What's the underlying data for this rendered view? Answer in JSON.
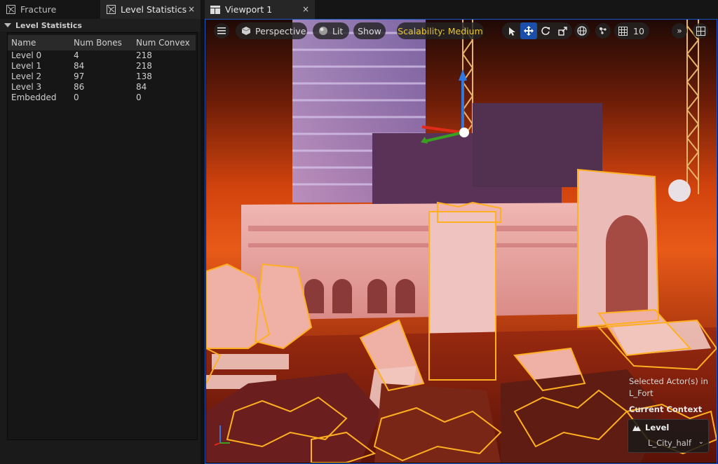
{
  "tabs": {
    "fracture": {
      "label": "Fracture"
    },
    "level_statistics": {
      "label": "Level Statistics",
      "close": "×"
    },
    "viewport": {
      "label": "Viewport 1",
      "close": "×"
    }
  },
  "panel": {
    "header": "Level Statistics",
    "columns": [
      "Name",
      "Num Bones",
      "Num Convex"
    ],
    "rows": [
      [
        "Level 0",
        "4",
        "218"
      ],
      [
        "Level 1",
        "84",
        "218"
      ],
      [
        "Level 2",
        "97",
        "138"
      ],
      [
        "Level 3",
        "86",
        "84"
      ],
      [
        "Embedded",
        "0",
        "0"
      ]
    ]
  },
  "toolbar": {
    "perspective": "Perspective",
    "lit": "Lit",
    "show": "Show",
    "scalability": "Scalability: Medium",
    "grid_value": "10",
    "scalability_color": "#e8c630"
  },
  "context": {
    "selected_line1": "Selected Actor(s) in",
    "selected_line2": "L_Fort",
    "current_context": "Current Context",
    "level_label": "Level",
    "level_value": "L_City_half"
  },
  "colors": {
    "accent": "#1b57c0",
    "selection_outline": "#ffb020"
  }
}
